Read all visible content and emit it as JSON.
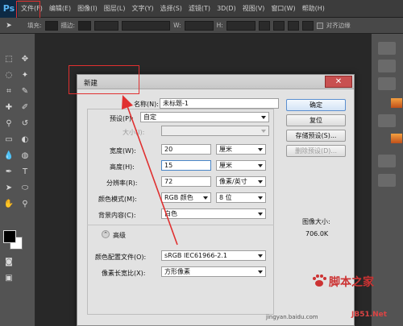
{
  "app": {
    "logo": "Ps"
  },
  "menu": [
    "文件(F)",
    "编辑(E)",
    "图像(I)",
    "图层(L)",
    "文字(Y)",
    "选择(S)",
    "滤镜(T)",
    "3D(D)",
    "视图(V)",
    "窗口(W)",
    "帮助(H)"
  ],
  "options_bar": {
    "fill_label": "填充:",
    "stroke_label": "描边:",
    "w_label": "W:",
    "h_label": "H:",
    "align_edges_label": "对齐边缘"
  },
  "dialog": {
    "title": "新建",
    "close_icon": "close-icon",
    "name_label": "名称(N):",
    "name_value": "未标题-1",
    "preset_label": "预设(P):",
    "preset_value": "自定",
    "size_label": "大小(I):",
    "width_label": "宽度(W):",
    "width_value": "20",
    "width_unit": "厘米",
    "height_label": "高度(H):",
    "height_value": "15",
    "height_unit": "厘米",
    "resolution_label": "分辨率(R):",
    "resolution_value": "72",
    "resolution_unit": "像素/英寸",
    "color_mode_label": "颜色模式(M):",
    "color_mode_value": "RGB 颜色",
    "bit_depth_value": "8 位",
    "bg_label": "背景内容(C):",
    "bg_value": "白色",
    "advanced_label": "高级",
    "color_profile_label": "颜色配置文件(O):",
    "color_profile_value": "sRGB IEC61966-2.1",
    "pixel_aspect_label": "像素长宽比(X):",
    "pixel_aspect_value": "方形像素",
    "ok_button": "确定",
    "reset_button": "复位",
    "save_preset_button": "存储预设(S)...",
    "delete_preset_button": "删除预设(D)...",
    "image_size_label": "图像大小:",
    "image_size_value": "706.0K"
  },
  "watermark": {
    "brand": "脚本之家",
    "url": "jingyan.baidu.com",
    "site": "JB51.Net"
  },
  "colors": {
    "highlight": "#e03030",
    "accent": "#5b8fd0"
  }
}
